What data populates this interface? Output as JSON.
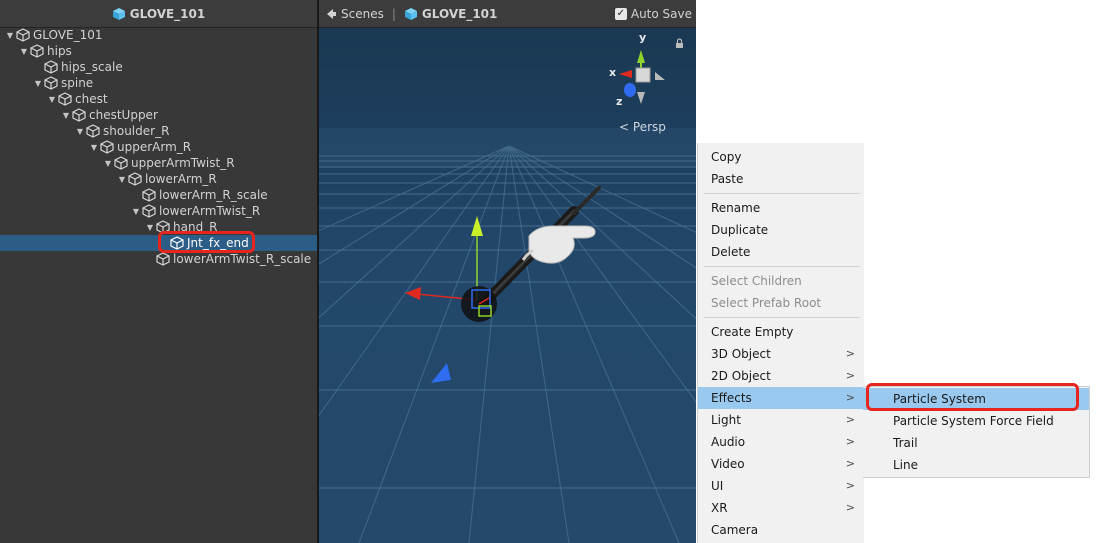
{
  "hierarchy": {
    "title": "GLOVE_101",
    "items": [
      {
        "label": "GLOVE_101"
      },
      {
        "label": "hips"
      },
      {
        "label": "hips_scale"
      },
      {
        "label": "spine"
      },
      {
        "label": "chest"
      },
      {
        "label": "chestUpper"
      },
      {
        "label": "shoulder_R"
      },
      {
        "label": "upperArm_R"
      },
      {
        "label": "upperArmTwist_R"
      },
      {
        "label": "lowerArm_R"
      },
      {
        "label": "lowerArm_R_scale"
      },
      {
        "label": "lowerArmTwist_R"
      },
      {
        "label": "hand_R"
      },
      {
        "label": "Jnt_fx_end"
      },
      {
        "label": "lowerArmTwist_R_scale"
      }
    ]
  },
  "scene": {
    "breadcrumb_scenes": "Scenes",
    "breadcrumb_title": "GLOVE_101",
    "auto_save_label": "Auto Save",
    "auto_save_checked": true,
    "gizmo_y": "y",
    "gizmo_x": "x",
    "gizmo_z": "z",
    "projection_label": "Persp"
  },
  "context_menu": {
    "items": [
      {
        "label": "Copy"
      },
      {
        "label": "Paste"
      },
      {
        "label": "Rename"
      },
      {
        "label": "Duplicate"
      },
      {
        "label": "Delete"
      },
      {
        "label": "Select Children"
      },
      {
        "label": "Select Prefab Root"
      },
      {
        "label": "Create Empty"
      },
      {
        "label": "3D Object"
      },
      {
        "label": "2D Object"
      },
      {
        "label": "Effects"
      },
      {
        "label": "Light"
      },
      {
        "label": "Audio"
      },
      {
        "label": "Video"
      },
      {
        "label": "UI"
      },
      {
        "label": "XR"
      },
      {
        "label": "Camera"
      }
    ],
    "submenu_arrow": ">"
  },
  "effects_submenu": {
    "items": [
      {
        "label": "Particle System"
      },
      {
        "label": "Particle System Force Field"
      },
      {
        "label": "Trail"
      },
      {
        "label": "Line"
      }
    ]
  },
  "colors": {
    "highlight_outline": "#e6251e",
    "selection_row": "#2c5d87",
    "menu_hover": "#99c9ef",
    "cube_icon": "#5ec0f0"
  }
}
